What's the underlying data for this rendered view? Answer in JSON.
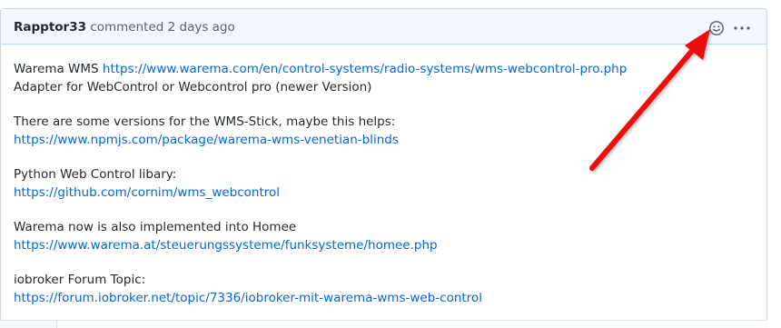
{
  "comment": {
    "author": "Rapptor33",
    "action": "commented",
    "time": "2 days ago",
    "paragraphs": [
      {
        "line1_text": "Warema WMS ",
        "line1_link": "https://www.warema.com/en/control-systems/radio-systems/wms-webcontrol-pro.php",
        "line2_text": "Adapter for WebControl or Webcontrol pro (newer Version)"
      },
      {
        "line1_text": "There are some versions for the WMS-Stick, maybe this helps:",
        "line2_link": "https://www.npmjs.com/package/warema-wms-venetian-blinds"
      },
      {
        "line1_text": "Python Web Control libary:",
        "line2_link": "https://github.com/cornim/wms_webcontrol"
      },
      {
        "line1_text": "Warema now is also implemented into Homee",
        "line2_link": "https://www.warema.at/steuerungssysteme/funksysteme/homee.php"
      },
      {
        "line1_text": "iobroker Forum Topic:",
        "line2_link": "https://forum.iobroker.net/topic/7336/iobroker-mit-warema-wms-web-control"
      }
    ]
  },
  "icons": {
    "emoji": "smiley-icon",
    "more": "kebab-horizontal-icon",
    "annotation": "red-arrow-icon"
  },
  "colors": {
    "header_bg": "#f1f8ff",
    "link": "#0366d6",
    "arrow": "#ee1111"
  }
}
